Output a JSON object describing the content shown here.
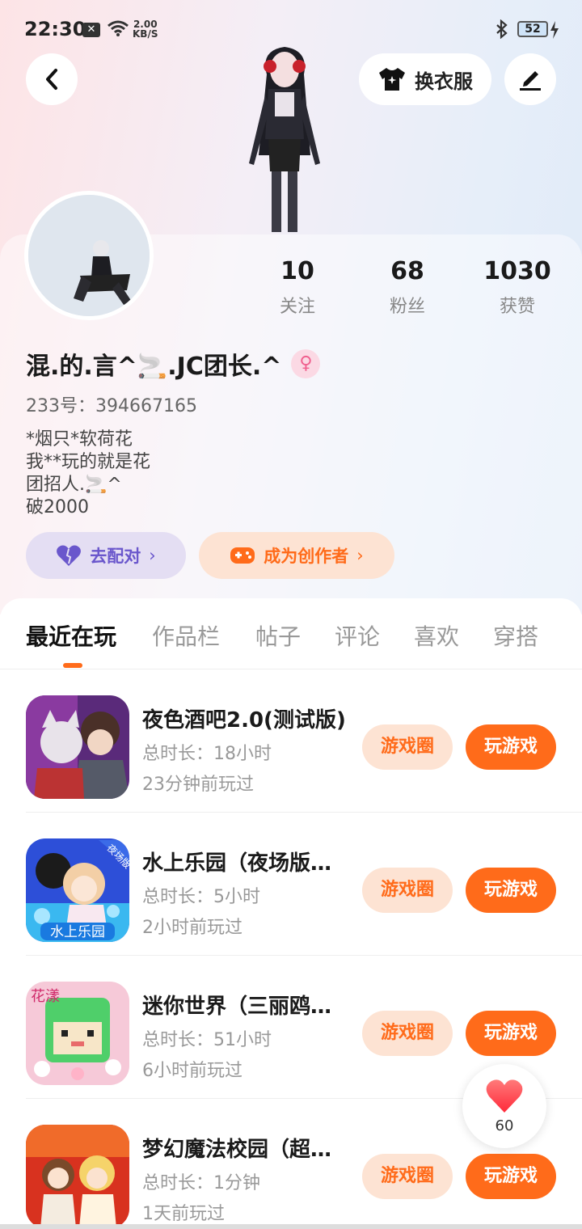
{
  "status_bar": {
    "time": "22:30",
    "net_speed_value": "2.00",
    "net_speed_unit": "KB/S",
    "battery": "52"
  },
  "header": {
    "outfit_label": "换衣服"
  },
  "profile": {
    "stats": [
      {
        "value": "10",
        "label": "关注"
      },
      {
        "value": "68",
        "label": "粉丝"
      },
      {
        "value": "1030",
        "label": "获赞"
      }
    ],
    "nickname": "混.的.言^🚬.JC团长.^",
    "gender_symbol": "♀",
    "id_text": "233号：394667165",
    "bio_lines": [
      "*烟只*软荷花",
      "我**玩的就是花",
      "团招人.🚬^",
      "破2000"
    ],
    "match_label": "去配对",
    "creator_label": "成为创作者"
  },
  "tabs": [
    "最近在玩",
    "作品栏",
    "帖子",
    "评论",
    "喜欢",
    "穿搭"
  ],
  "games": [
    {
      "title": "夜色酒吧2.0(测试版)",
      "duration": "总时长：18小时",
      "last_played": "23分钟前玩过",
      "circle_label": "游戏圈",
      "play_label": "玩游戏"
    },
    {
      "title": "水上乐园（夜场版…",
      "duration": "总时长：5小时",
      "last_played": "2小时前玩过",
      "circle_label": "游戏圈",
      "play_label": "玩游戏"
    },
    {
      "title": "迷你世界（三丽鸥…",
      "duration": "总时长：51小时",
      "last_played": "6小时前玩过",
      "circle_label": "游戏圈",
      "play_label": "玩游戏"
    },
    {
      "title": "梦幻魔法校园（超…",
      "duration": "总时长：1分钟",
      "last_played": "1天前玩过",
      "circle_label": "游戏圈",
      "play_label": "玩游戏"
    }
  ],
  "game_icon_texts": {
    "game2_badge": "夜场版",
    "game2_name": "水上乐园",
    "game3_badge": "花漾"
  },
  "like_float": {
    "count": "60"
  },
  "colors": {
    "accent": "#ff6b1a",
    "match_purple": "#6a57cc",
    "pink": "#f0608e"
  }
}
